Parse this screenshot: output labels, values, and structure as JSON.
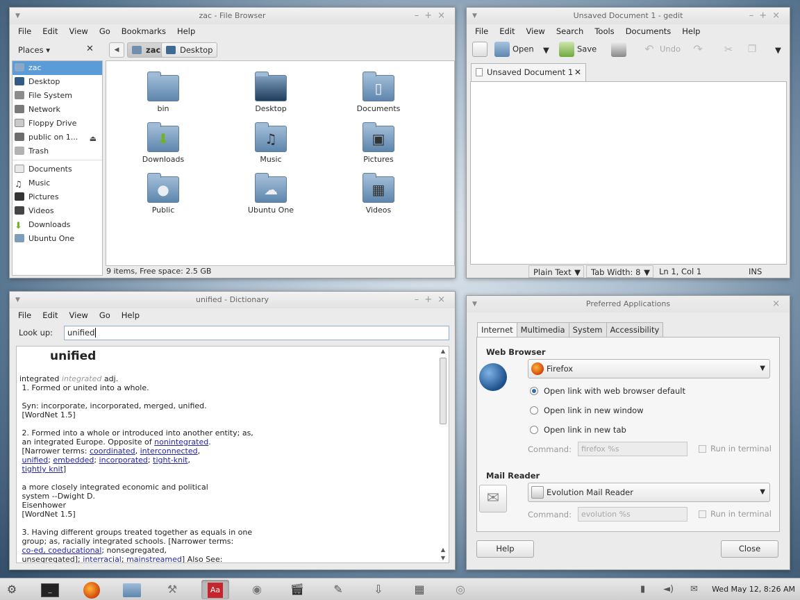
{
  "file_browser": {
    "title": "zac - File Browser",
    "menu": [
      "File",
      "Edit",
      "View",
      "Go",
      "Bookmarks",
      "Help"
    ],
    "places_label": "Places",
    "path_buttons": [
      "zac",
      "Desktop"
    ],
    "sidebar": [
      {
        "label": "zac",
        "icon": "home-icon"
      },
      {
        "label": "Desktop",
        "icon": "desktop-icon"
      },
      {
        "label": "File System",
        "icon": "harddisk-icon"
      },
      {
        "label": "Network",
        "icon": "network-icon"
      },
      {
        "label": "Floppy Drive",
        "icon": "floppy-icon"
      },
      {
        "label": "public on 1...",
        "icon": "network-share-icon"
      },
      {
        "label": "Trash",
        "icon": "trash-icon"
      },
      {
        "label": "Documents",
        "icon": "documents-folder-icon"
      },
      {
        "label": "Music",
        "icon": "music-icon"
      },
      {
        "label": "Pictures",
        "icon": "pictures-icon"
      },
      {
        "label": "Videos",
        "icon": "videos-icon"
      },
      {
        "label": "Downloads",
        "icon": "downloads-icon"
      },
      {
        "label": "Ubuntu One",
        "icon": "ubuntu-one-icon"
      }
    ],
    "folders": [
      {
        "label": "bin",
        "glyph": ""
      },
      {
        "label": "Desktop",
        "glyph": ""
      },
      {
        "label": "Documents",
        "glyph": "▯"
      },
      {
        "label": "Downloads",
        "glyph": "⬇"
      },
      {
        "label": "Music",
        "glyph": "♫"
      },
      {
        "label": "Pictures",
        "glyph": "▣"
      },
      {
        "label": "Public",
        "glyph": "●"
      },
      {
        "label": "Ubuntu One",
        "glyph": "☁"
      },
      {
        "label": "Videos",
        "glyph": "▦"
      }
    ],
    "status": "9 items, Free space: 2.5 GB"
  },
  "gedit": {
    "title": "Unsaved Document 1 - gedit",
    "menu": [
      "File",
      "Edit",
      "View",
      "Search",
      "Tools",
      "Documents",
      "Help"
    ],
    "toolbar": {
      "open": "Open",
      "save": "Save",
      "undo": "Undo"
    },
    "tab_label": "Unsaved Document 1",
    "status": {
      "syntax": "Plain Text",
      "tab_width": "Tab Width:  8",
      "position": "Ln 1, Col 1",
      "mode": "INS"
    }
  },
  "dictionary": {
    "title": "unified - Dictionary",
    "menu": [
      "File",
      "Edit",
      "View",
      "Go",
      "Help"
    ],
    "lookup_label": "Look up:",
    "lookup_value": "unified",
    "headword": "unified",
    "entry": {
      "line1_word": "integrated",
      "line1_pron": "integrated",
      "line1_pos": "adj.",
      "sense1": "1. Formed or united into a whole.",
      "syn1": "Syn: incorporate, incorporated, merged, unified.",
      "source": "[WordNet 1.5]",
      "sense2a": "2. Formed into a whole or introduced into another entity; as,",
      "sense2b": "an integrated Europe. Opposite of",
      "link_nonintegrated": "nonintegrated",
      "narrower_label": "[Narrower terms:",
      "link_coordinated": "coordinated",
      "link_interconnected": "interconnected",
      "link_unified": "unified",
      "link_embedded": "embedded",
      "link_incorporated": "incorporated",
      "link_tightknit": "tight-knit",
      "link_tightlyknit": "tightly knit",
      "example1": "a more closely integrated economic and political",
      "example2": "system --Dwight D.",
      "example3": "Eisenhower",
      "sense3a": "3. Having different groups treated together as equals in one",
      "sense3b": "group; as, racially integrated schools. [Narrower terms:",
      "link_coed": "co-ed, coeducational",
      "sense3c": "; nonsegregated,",
      "sense3d": "unsegregated]; ",
      "link_interracial": "interracial",
      "link_mainstreamed": "mainstreamed",
      "sense3e": "] Also See:"
    }
  },
  "preferred_apps": {
    "title": "Preferred Applications",
    "tabs": [
      "Internet",
      "Multimedia",
      "System",
      "Accessibility"
    ],
    "web_browser": {
      "heading": "Web Browser",
      "selected": "Firefox",
      "radios": [
        "Open link with web browser default",
        "Open link in new window",
        "Open link in new tab"
      ],
      "command_label": "Command:",
      "command_value": "firefox %s",
      "run_in_terminal": "Run in terminal"
    },
    "mail_reader": {
      "heading": "Mail Reader",
      "selected": "Evolution Mail Reader",
      "command_label": "Command:",
      "command_value": "evolution %s",
      "run_in_terminal": "Run in terminal"
    },
    "help_button": "Help",
    "close_button": "Close"
  },
  "taskbar": {
    "clock": "Wed May 12,  8:26 AM"
  }
}
